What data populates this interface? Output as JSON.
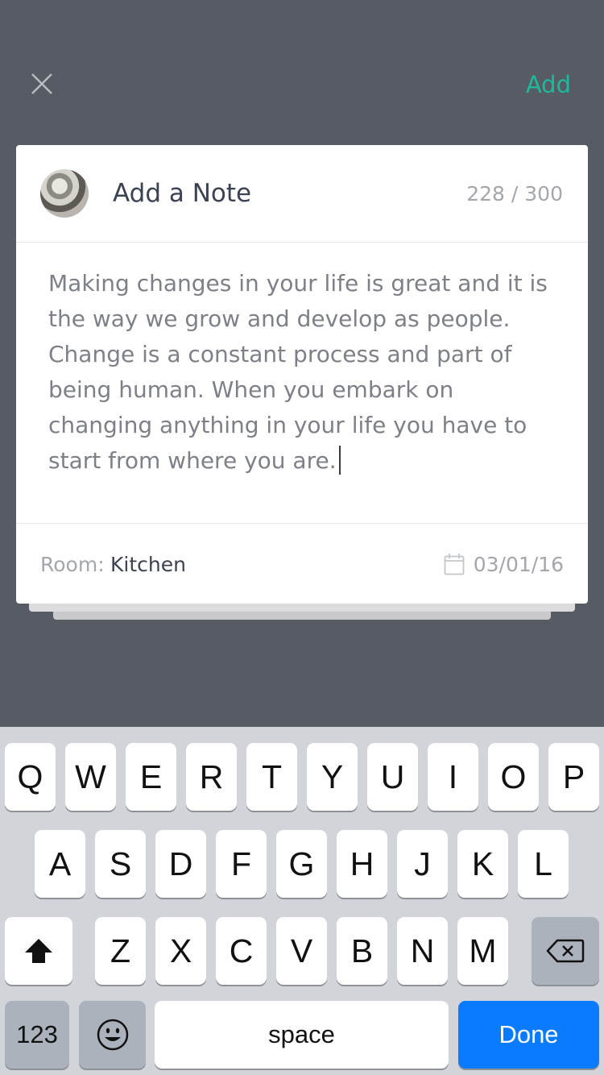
{
  "topbar": {
    "add_label": "Add"
  },
  "card": {
    "title": "Add a Note",
    "char_count": "228 / 300",
    "note_text": "Making changes in your life is great and it is the way we grow and develop as people. Change is a constant process and part of being human. When you embark on changing anything in your life you have to start from where you are.",
    "room_label": "Room:",
    "room_value": "Kitchen",
    "date": "03/01/16"
  },
  "keyboard": {
    "row1": [
      "Q",
      "W",
      "E",
      "R",
      "T",
      "Y",
      "U",
      "I",
      "O",
      "P"
    ],
    "row2": [
      "A",
      "S",
      "D",
      "F",
      "G",
      "H",
      "J",
      "K",
      "L"
    ],
    "row3": [
      "Z",
      "X",
      "C",
      "V",
      "B",
      "N",
      "M"
    ],
    "numbers_label": "123",
    "space_label": "space",
    "done_label": "Done"
  },
  "icons": [
    "close-icon",
    "avatar",
    "calendar-icon",
    "shift-icon",
    "backspace-icon",
    "emoji-icon"
  ],
  "colors": {
    "accent": "#1fb89a",
    "backdrop": "#575b63",
    "done_key": "#0a7aff"
  }
}
